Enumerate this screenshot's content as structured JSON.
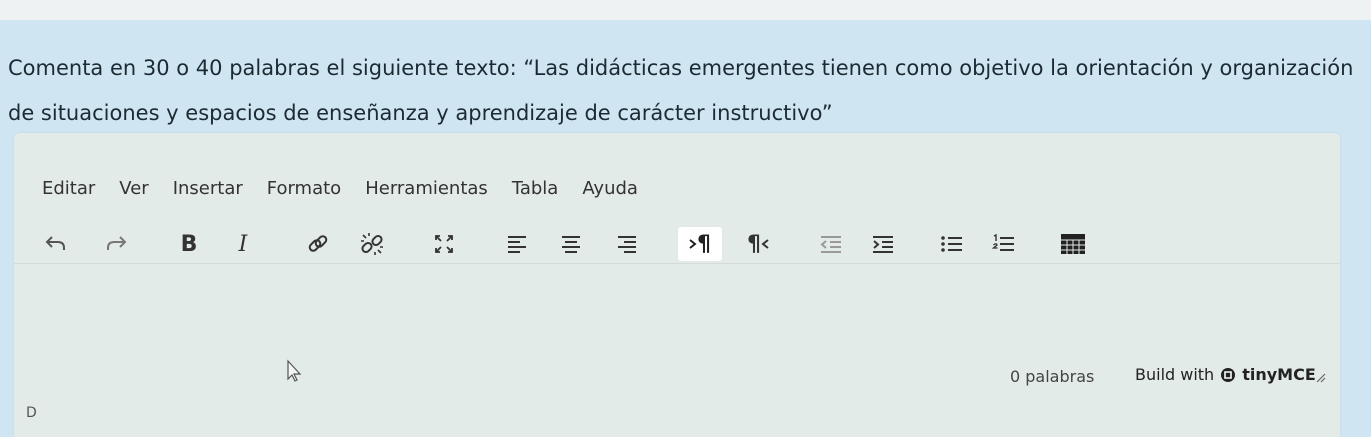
{
  "question": {
    "text": "Comenta en 30 o 40 palabras el siguiente texto: “Las didácticas emergentes tienen como objetivo la orientación y organización de situaciones y espacios de enseñanza y aprendizaje de carácter instructivo”"
  },
  "menubar": {
    "items": [
      "Editar",
      "Ver",
      "Insertar",
      "Formato",
      "Herramientas",
      "Tabla",
      "Ayuda"
    ]
  },
  "toolbar": {
    "bold_label": "B",
    "italic_label": "I",
    "ltr_label": "¶",
    "rtl_label": "¶"
  },
  "statusbar": {
    "word_count": "0 palabras",
    "build_with": "Build with",
    "brand": "tinyMCE"
  },
  "corner_mark": "D",
  "colors": {
    "panel": "#cfe6f2",
    "editor": "#e3ebe8",
    "active_button": "#ffffff",
    "text": "#333333"
  }
}
